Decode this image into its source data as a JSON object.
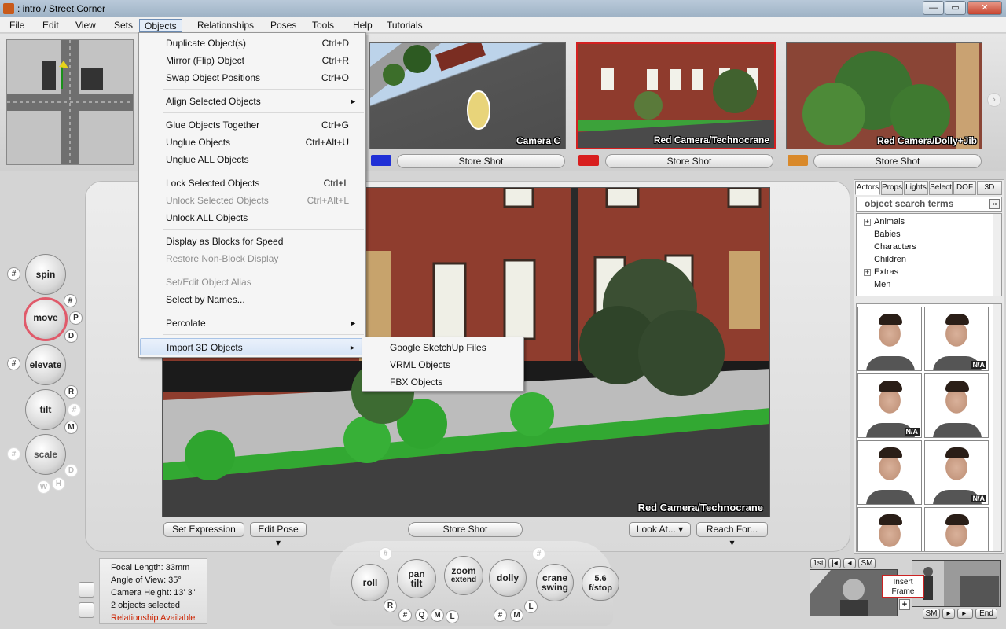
{
  "window": {
    "title": ":  intro  /  Street Corner",
    "minimize": "—",
    "maximize": "▭",
    "close": "✕"
  },
  "menubar": [
    "File",
    "Edit",
    "View",
    "Sets",
    "Objects",
    "Relationships",
    "Poses",
    "Tools",
    "Help",
    "Tutorials"
  ],
  "objects_menu": {
    "items": [
      {
        "label": "Duplicate Object(s)",
        "shortcut": "Ctrl+D"
      },
      {
        "label": "Mirror (Flip) Object",
        "shortcut": "Ctrl+R"
      },
      {
        "label": "Swap Object Positions",
        "shortcut": "Ctrl+O"
      },
      {
        "label": "Align Selected Objects",
        "shortcut": "►"
      },
      {
        "label": "Glue Objects Together",
        "shortcut": "Ctrl+G"
      },
      {
        "label": "Unglue Objects",
        "shortcut": "Ctrl+Alt+U"
      },
      {
        "label": "Unglue ALL Objects",
        "shortcut": ""
      },
      {
        "label": "Lock Selected Objects",
        "shortcut": "Ctrl+L"
      },
      {
        "label": "Unlock Selected Objects",
        "shortcut": "Ctrl+Alt+L"
      },
      {
        "label": "Unlock ALL Objects",
        "shortcut": ""
      },
      {
        "label": "Display as Blocks for Speed",
        "shortcut": ""
      },
      {
        "label": "Restore Non-Block Display",
        "shortcut": ""
      },
      {
        "label": "Set/Edit Object Alias",
        "shortcut": ""
      },
      {
        "label": "Select by Names...",
        "shortcut": ""
      },
      {
        "label": "Percolate",
        "shortcut": "►"
      },
      {
        "label": "Import 3D Objects",
        "shortcut": "►"
      }
    ],
    "import_submenu": [
      "Google SketchUp Files",
      "VRML Objects",
      "FBX Objects"
    ]
  },
  "cameras": [
    {
      "label": "Camera C",
      "store": "Store Shot",
      "color": "#1f2fd6"
    },
    {
      "label": "Red Camera/Technocrane",
      "store": "Store Shot",
      "color": "#d81e1e"
    },
    {
      "label": "Red Camera/Dolly+Jib",
      "store": "Store Shot",
      "color": "#d9892a"
    }
  ],
  "left_controls": {
    "spin": "spin",
    "move": "move",
    "elevate": "elevate",
    "tilt": "tilt",
    "scale": "scale",
    "hash": "#",
    "P": "P",
    "D": "D",
    "R": "R",
    "M": "M",
    "W": "W",
    "H": "H"
  },
  "viewport": {
    "label": "Red Camera/Technocrane",
    "set_expression": "Set Expression",
    "edit_pose": "Edit Pose ▾",
    "store_shot": "Store Shot",
    "look_at": "Look At... ▾",
    "reach_for": "Reach For... ▾"
  },
  "right_panel": {
    "tabs": [
      "Actors",
      "Props",
      "Lights",
      "Select",
      "DOF",
      "3D"
    ],
    "search_placeholder": "object search terms",
    "tree": [
      "Animals",
      "Babies",
      "Characters",
      "Children",
      "Extras",
      "Men"
    ],
    "na_label": "N/A"
  },
  "info": {
    "focal": "Focal Length: 33mm",
    "angle": "Angle of View: 35°",
    "height": "Camera Height: 13' 3\"",
    "selected": "2 objects selected",
    "relationship": "Relationship Available"
  },
  "bottom_controls": {
    "roll": "roll",
    "pan": "pan",
    "tilt": "tilt",
    "zoom": "zoom",
    "extend": "extend",
    "dolly": "dolly",
    "crane": "crane",
    "swing": "swing",
    "fstop_value": "5.6",
    "fstop": "f/stop",
    "R": "R",
    "Q": "Q",
    "M": "M",
    "L": "L",
    "hash": "#"
  },
  "timeline": {
    "first": "1st",
    "sm": "SM",
    "end": "End",
    "insert_frame": "Insert Frame",
    "plus": "+"
  }
}
